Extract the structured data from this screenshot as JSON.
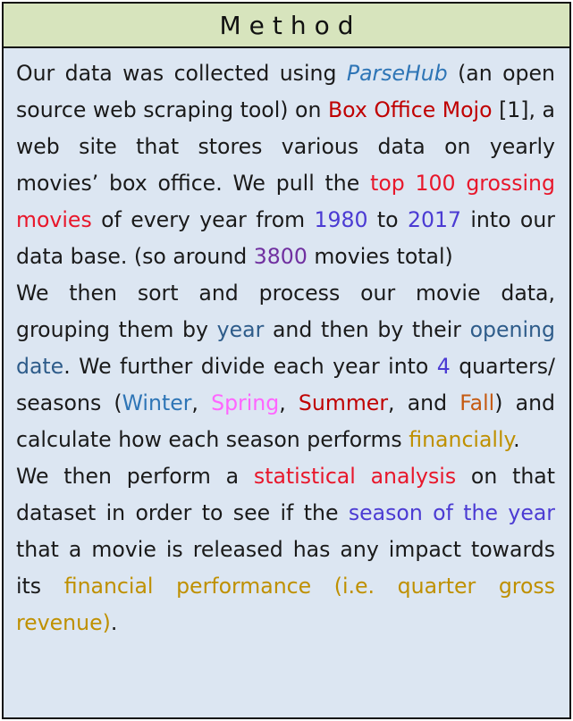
{
  "header": {
    "title": "Method"
  },
  "colors": {
    "header_bg": "#d7e4bd",
    "panel_bg": "#dce6f2",
    "text": "#1a1a1a",
    "blue": "#2e75b6",
    "red": "#c00000",
    "bright_red": "#e8172b",
    "indigo": "#4b3bd3",
    "purple": "#7030a0",
    "steel_blue": "#2e5c8a",
    "pink": "#ff66ff",
    "orange": "#c55a11",
    "gold": "#bf9000"
  },
  "paragraphs": [
    {
      "segments": [
        {
          "text": "Our data was collected using ",
          "color": "text"
        },
        {
          "text": "ParseHub",
          "color": "blue",
          "italic": true
        },
        {
          "text": " (an open source web scraping tool) on ",
          "color": "text"
        },
        {
          "text": "Box Office Mojo",
          "color": "red"
        },
        {
          "text": " [1], a web site that stores various data on yearly movies’ box office. We pull the ",
          "color": "text"
        },
        {
          "text": "top 100 grossing movies",
          "color": "bright_red"
        },
        {
          "text": " of every year from ",
          "color": "text"
        },
        {
          "text": "1980",
          "color": "indigo"
        },
        {
          "text": " to ",
          "color": "text"
        },
        {
          "text": "2017",
          "color": "indigo"
        },
        {
          "text": " into our data base. (so around ",
          "color": "text"
        },
        {
          "text": "3800",
          "color": "purple"
        },
        {
          "text": " movies total)",
          "color": "text"
        }
      ]
    },
    {
      "segments": [
        {
          "text": "We then sort and process our movie data, grouping them by ",
          "color": "text"
        },
        {
          "text": "year",
          "color": "steel_blue"
        },
        {
          "text": " and then by their ",
          "color": "text"
        },
        {
          "text": "opening date",
          "color": "steel_blue"
        },
        {
          "text": ". We further divide each year into ",
          "color": "text"
        },
        {
          "text": "4",
          "color": "indigo"
        },
        {
          "text": " quarters/ seasons (",
          "color": "text"
        },
        {
          "text": "Winter",
          "color": "blue"
        },
        {
          "text": ", ",
          "color": "text"
        },
        {
          "text": "Spring",
          "color": "pink"
        },
        {
          "text": ", ",
          "color": "text"
        },
        {
          "text": "Summer",
          "color": "red"
        },
        {
          "text": ", and ",
          "color": "text"
        },
        {
          "text": "Fall",
          "color": "orange"
        },
        {
          "text": ") and calculate how each season performs ",
          "color": "text"
        },
        {
          "text": "financially",
          "color": "gold"
        },
        {
          "text": ".",
          "color": "text"
        }
      ]
    },
    {
      "segments": [
        {
          "text": "We then perform a ",
          "color": "text"
        },
        {
          "text": "statistical analysis",
          "color": "bright_red"
        },
        {
          "text": " on that dataset in order to see if the ",
          "color": "text"
        },
        {
          "text": "season of the year",
          "color": "indigo"
        },
        {
          "text": " that a movie is released has any impact towards its ",
          "color": "text"
        },
        {
          "text": "financial performance (i.e. quarter gross revenue)",
          "color": "gold"
        },
        {
          "text": ".",
          "color": "text"
        }
      ]
    }
  ]
}
